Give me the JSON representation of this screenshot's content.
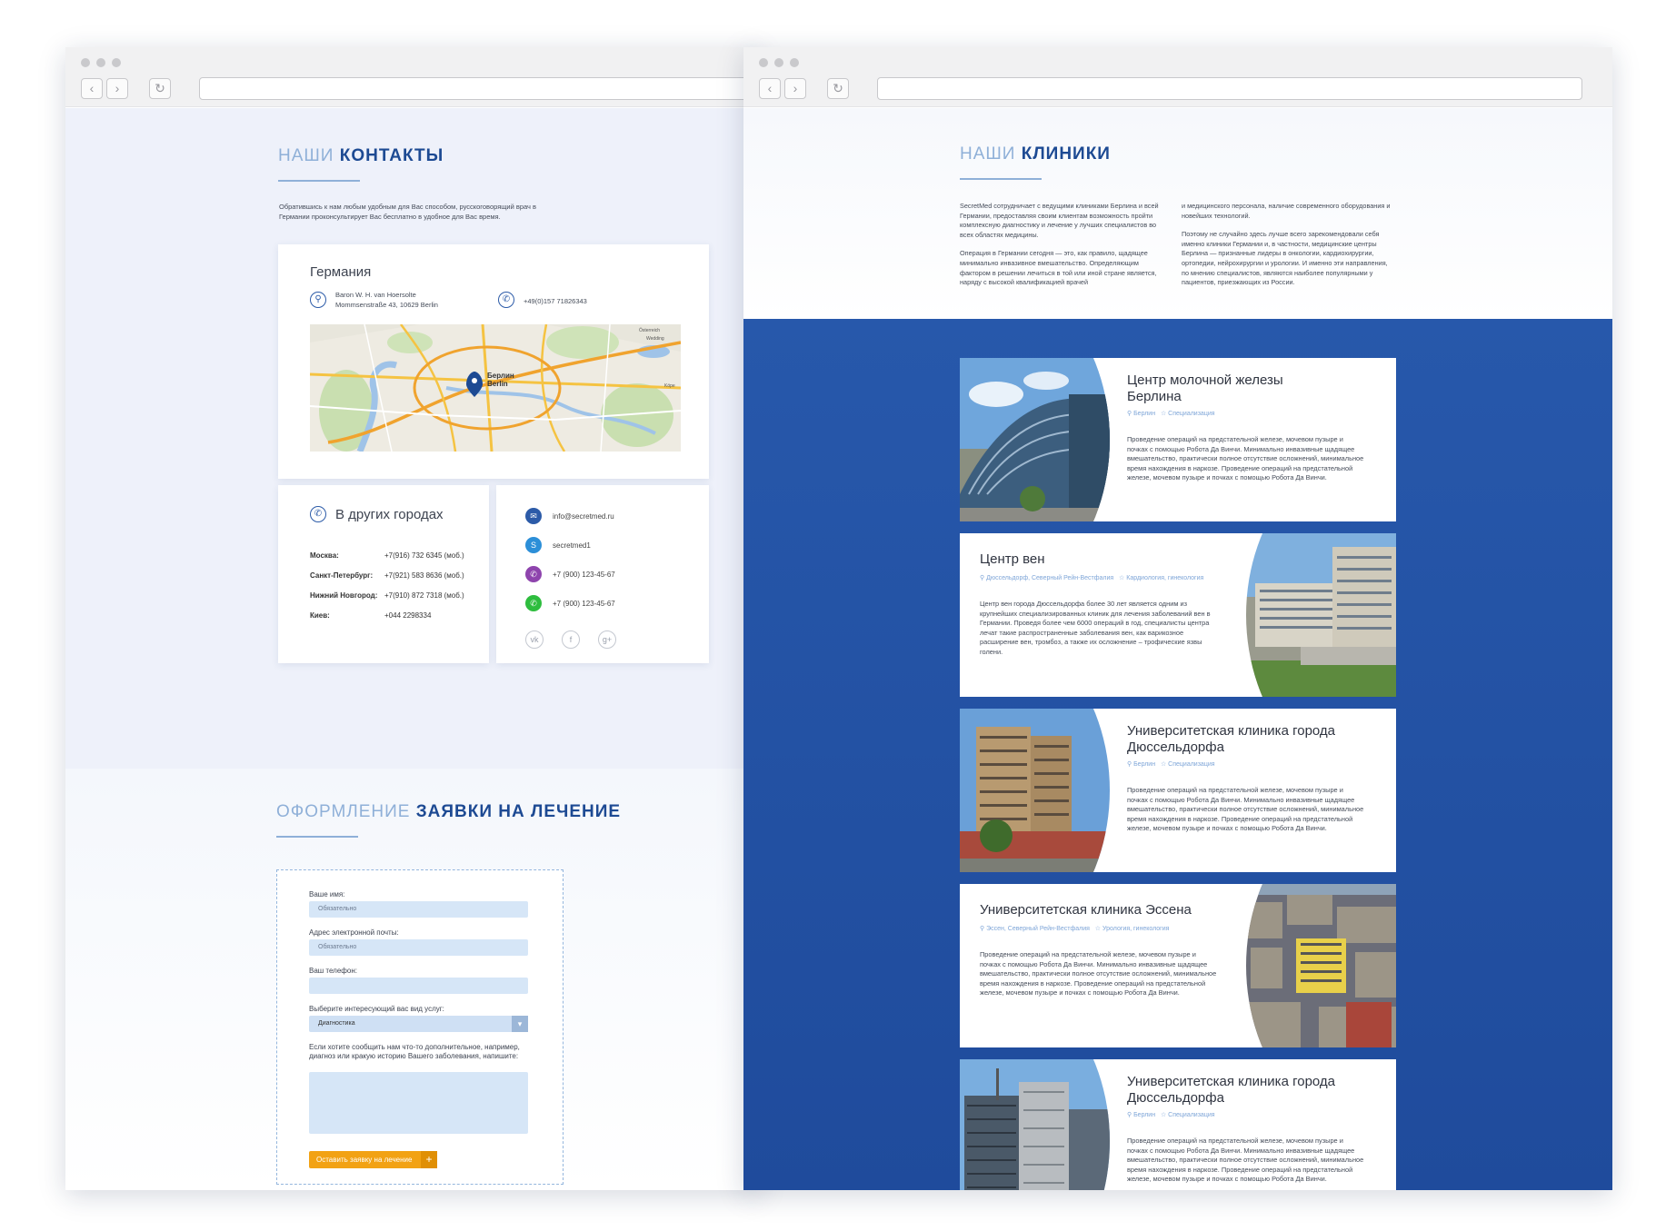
{
  "contacts": {
    "title_light": "НАШИ",
    "title_dark": "КОНТАКТЫ",
    "intro": "Обратившись к нам любым удобным для Вас способом, русскоговорящий врач в Германии проконсультирует Вас бесплатно в удобное для Вас время.",
    "germany": {
      "heading": "Германия",
      "address_line1": "Baron W. H. van Hoersolte",
      "address_line2": "Mommsenstraße 43, 10629 Berlin",
      "phone": "+49(0)157 71826343",
      "map_label_ru": "Берлин",
      "map_label_de": "Berlin",
      "map_corner1": "Österreich",
      "map_corner2": "Wedding",
      "map_corner3": "Köpe"
    },
    "other_cities": {
      "heading": "В других городах",
      "rows": [
        {
          "city": "Москва:",
          "phone": "+7(916) 732 6345 (моб.)"
        },
        {
          "city": "Санкт-Петербург:",
          "phone": "+7(921) 583 8636 (моб.)"
        },
        {
          "city": "Нижний Новгород:",
          "phone": "+7(910) 872 7318 (моб.)"
        },
        {
          "city": "Киев:",
          "phone": "+044 2298334"
        }
      ]
    },
    "channels": [
      {
        "icon": "email-icon",
        "color": "#2c5ba8",
        "text": "info@secretmed.ru"
      },
      {
        "icon": "skype-icon",
        "color": "#2c8fd8",
        "text": "secretmed1"
      },
      {
        "icon": "viber-icon",
        "color": "#8e44ad",
        "text": "+7 (900) 123-45-67"
      },
      {
        "icon": "whatsapp-icon",
        "color": "#2ebd3e",
        "text": "+7 (900) 123-45-67"
      }
    ],
    "social": [
      {
        "icon": "vk-icon",
        "glyph": "vk"
      },
      {
        "icon": "facebook-icon",
        "glyph": "f"
      },
      {
        "icon": "google-plus-icon",
        "glyph": "g+"
      }
    ]
  },
  "application": {
    "title_light": "ОФОРМЛЕНИЕ",
    "title_dark": "ЗАЯВКИ НА ЛЕЧЕНИЕ",
    "name_label": "Ваше имя:",
    "name_placeholder": "Обязательно",
    "email_label": "Адрес электронной почты:",
    "email_placeholder": "Обязательно",
    "phone_label": "Ваш телефон:",
    "service_label": "Выберите интересующий вас вид услуг:",
    "service_value": "Диагностика",
    "message_label": "Если хотите сообщить нам что-то дополнительное, например, диагноз или кракую историю Вашего заболевания, напишите:",
    "submit_label": "Оставить заявку на лечение",
    "submit_plus": "+"
  },
  "clinics": {
    "title_light": "НАШИ",
    "title_dark": "КЛИНИКИ",
    "col1": [
      "SecretMed сотрудничает с ведущими клиниками Берлина и всей Германии, предоставляя своим клиентам возможность пройти комплексную диагностику и лечение у лучших специалистов во всех областях медицины.",
      "Операция в Германии сегодня — это, как правило, щадящее минимально инвазивное вмешательство. Определяющим фактором в решении лечиться в той или иной стране является, наряду с высокой квалификацией врачей"
    ],
    "col2": [
      "и медицинского персонала, наличие современного оборудования и новейших технологий.",
      "Поэтому не случайно здесь лучше всего зарекомендовали себя именно клиники Германии и, в частности, медицинские центры Берлина — признанные лидеры в онкологии, кардиохирургии, ортопедии, нейрохирургии и урологии. И именно эти направления, по мнению специалистов, являются наиболее популярными у пациентов, приезжающих из России."
    ],
    "items": [
      {
        "title": "Центр молочной железы Берлина",
        "location": "Берлин",
        "specialty": "Специализация",
        "description": "Проведение операций на предстательной железе, мочевом пузыре и почках с помощью Робота Да Винчи. Минимально инвазивные щадящее вмешательство, практически полное отсутствие осложнений, минимальное время нахождения в наркозе. Проведение операций на предстательной железе, мочевом пузыре и почках с помощью Робота Да Винчи."
      },
      {
        "title": "Центр вен",
        "location": "Дюссельдорф, Северный Рейн-Вестфалия",
        "specialty": "Кардиология, гинекология",
        "description": "Центр вен города Дюссельдорфа более 30 лет является одним из крупнейших специализированных клиник для лечения заболеваний вен в Германии. Проведя более чем 6000 операций в год, специалисты центра лечат такие распространенные заболевания вен, как варикозное расширение вен, тромбоз, а также их осложнение – трофические язвы голени."
      },
      {
        "title": "Университетская клиника города Дюссельдорфа",
        "location": "Берлин",
        "specialty": "Специализация",
        "description": "Проведение операций на предстательной железе, мочевом пузыре и почках с помощью Робота Да Винчи. Минимально инвазивные щадящее вмешательство, практически полное отсутствие осложнений, минимальное время нахождения в наркозе. Проведение операций на предстательной железе, мочевом пузыре и почках с помощью Робота Да Винчи."
      },
      {
        "title": "Университетская клиника Эссена",
        "location": "Эссен, Северный Рейн-Вестфалия",
        "specialty": "Урология, гинекология",
        "description": "Проведение операций на предстательной железе, мочевом пузыре и почках с помощью Робота Да Винчи. Минимально инвазивные щадящее вмешательство, практически полное отсутствие осложнений, минимальное время нахождения в наркозе. Проведение операций на предстательной железе, мочевом пузыре и почках с помощью Робота Да Винчи."
      },
      {
        "title": "Университетская клиника города Дюссельдорфа",
        "location": "Берлин",
        "specialty": "Специализация",
        "description": "Проведение операций на предстательной железе, мочевом пузыре и почках с помощью Робота Да Винчи. Минимально инвазивные щадящее вмешательство, практически полное отсутствие осложнений, минимальное время нахождения в наркозе. Проведение операций на предстательной железе, мочевом пузыре и почках с помощью Робота Да Винчи."
      }
    ]
  },
  "colors": {
    "accent_blue": "#1d4a93",
    "light_blue": "#8fb0d8",
    "orange": "#f2a214",
    "clinics_bg": "#2455a8"
  }
}
